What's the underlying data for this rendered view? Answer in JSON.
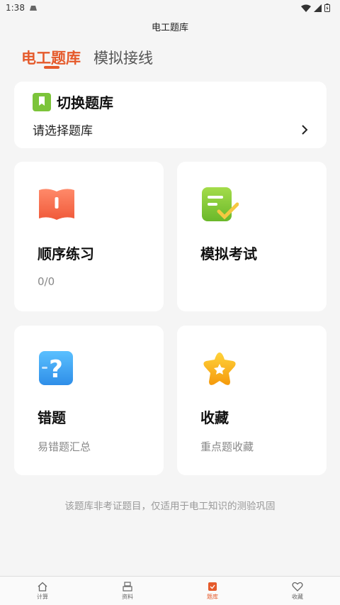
{
  "status": {
    "time": "1:38"
  },
  "app": {
    "title": "电工题库"
  },
  "tabs": [
    {
      "label": "电工题库",
      "active": true
    },
    {
      "label": "模拟接线",
      "active": false
    }
  ],
  "bank": {
    "title": "切换题库",
    "select_label": "请选择题库"
  },
  "cards": {
    "sequential": {
      "title": "顺序练习",
      "sub": "0/0"
    },
    "exam": {
      "title": "模拟考试"
    },
    "mistakes": {
      "title": "错题",
      "sub": "易错题汇总"
    },
    "favorites": {
      "title": "收藏",
      "sub": "重点题收藏"
    }
  },
  "disclaimer": "该题库非考证题目，仅适用于电工知识的测验巩固",
  "nav": [
    {
      "label": "计算",
      "icon": "home-icon"
    },
    {
      "label": "资料",
      "icon": "document-icon"
    },
    {
      "label": "题库",
      "icon": "question-bank-icon",
      "active": true
    },
    {
      "label": "收藏",
      "icon": "heart-icon"
    }
  ],
  "colors": {
    "accent": "#e55a2b",
    "green": "#7cc43a",
    "blue": "#3aa5f0",
    "yellow": "#f7b51a"
  }
}
